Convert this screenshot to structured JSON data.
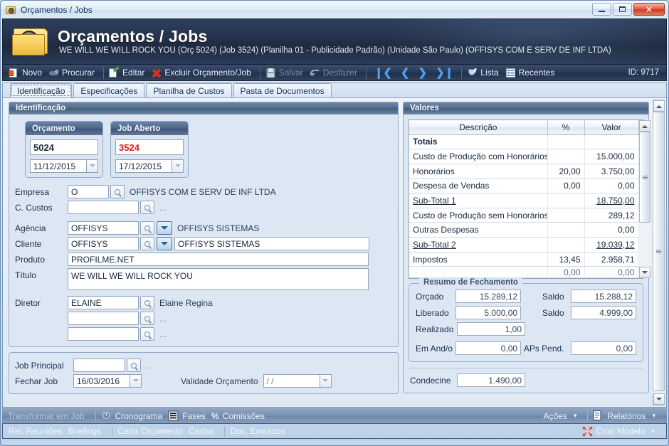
{
  "window": {
    "titlebar_text": "Orçamentos / Jobs",
    "icon": "folder-film-icon",
    "minimize_label": "Minimizar",
    "maximize_label": "Maximizar",
    "close_label": "✕"
  },
  "banner": {
    "title": "Orçamentos / Jobs",
    "subtitle": "WE WILL WE WILL ROCK YOU (Orç 5024) (Job 3524)  (Planilha 01 - Publicidade Padrão) (Unidade São Paulo) (OFFISYS COM E SERV DE INF LTDA)"
  },
  "toolbar": {
    "novo": "Novo",
    "procurar": "Procurar",
    "editar": "Editar",
    "excluir": "Excluir Orçamento/Job",
    "salvar": "Salvar",
    "desfazer": "Desfazer",
    "nav_first": "❙❮",
    "nav_prev": "❮",
    "nav_next": "❯",
    "nav_last": "❯❙",
    "lista": "Lista",
    "recentes": "Recentes",
    "id": "ID: 9717"
  },
  "tabs": [
    {
      "label": "Identificação",
      "active": true
    },
    {
      "label": "Especificações",
      "active": false
    },
    {
      "label": "Planilha de Custos",
      "active": false
    },
    {
      "label": "Pasta de Documentos",
      "active": false
    }
  ],
  "identificacao": {
    "group_title": "Identificação",
    "orcamento": {
      "header": "Orçamento",
      "number": "5024",
      "date": "11/12/2015"
    },
    "job_aberto": {
      "header": "Job Aberto",
      "number": "3524",
      "date": "17/12/2015"
    },
    "fields": {
      "empresa_label": "Empresa",
      "empresa_value": "O",
      "empresa_desc": "OFFISYS COM E SERV DE INF LTDA",
      "ccustos_label": "C. Custos",
      "ccustos_value": "",
      "ccustos_desc": "...",
      "agencia_label": "Agência",
      "agencia_value": "OFFISYS",
      "agencia_desc": "OFFISYS SISTEMAS",
      "cliente_label": "Cliente",
      "cliente_value": "OFFISYS",
      "cliente_desc": "OFFISYS SISTEMAS",
      "produto_label": "Produto",
      "produto_value": "PROFILME.NET",
      "titulo_label": "Título",
      "titulo_value": "WE WILL WE WILL ROCK YOU",
      "diretor_label": "Diretor",
      "diretor_value": "ELAINE",
      "diretor_desc": "Elaine Regina",
      "extra1_value": "",
      "extra1_desc": "...",
      "extra2_value": "",
      "extra2_desc": "..."
    }
  },
  "job_panel": {
    "job_principal_label": "Job Principal",
    "job_principal_value": "",
    "job_principal_desc": "...",
    "fechar_job_label": "Fechar Job",
    "fechar_job_value": "16/03/2016",
    "validade_label": "Validade Orçamento",
    "validade_value": "/  /"
  },
  "valores": {
    "group_title": "Valores",
    "columns": [
      "Descrição",
      "%",
      "Valor"
    ],
    "rows": [
      {
        "desc": "Totais",
        "pct": "",
        "val": "",
        "style": "bold"
      },
      {
        "desc": "Custo de Produção com Honorários",
        "pct": "",
        "val": "15.000,00",
        "style": ""
      },
      {
        "desc": "Honorários",
        "pct": "20,00",
        "val": "3.750,00",
        "style": ""
      },
      {
        "desc": "Despesa de Vendas",
        "pct": "0,00",
        "val": "0,00",
        "style": ""
      },
      {
        "desc": "Sub-Total 1",
        "pct": "",
        "val": "18.750,00",
        "style": "subtotal"
      },
      {
        "desc": "Custo de Produção sem Honorários",
        "pct": "",
        "val": "289,12",
        "style": ""
      },
      {
        "desc": "Outras Despesas",
        "pct": "",
        "val": "0,00",
        "style": ""
      },
      {
        "desc": "Sub-Total 2",
        "pct": "",
        "val": "19.039,12",
        "style": "subtotal"
      },
      {
        "desc": "Impostos",
        "pct": "13,45",
        "val": "2.958,71",
        "style": ""
      },
      {
        "desc": "",
        "pct": "0,00",
        "val": "0,00",
        "style": "clip"
      }
    ]
  },
  "resumo": {
    "legend": "Resumo de Fechamento",
    "orcado_label": "Orçado",
    "orcado_value": "15.289,12",
    "saldo1_label": "Saldo",
    "saldo1_value": "15.288,12",
    "liberado_label": "Liberado",
    "liberado_value": "5.000,00",
    "saldo2_label": "Saldo",
    "saldo2_value": "4.999,00",
    "realizado_label": "Realizado",
    "realizado_value": "1,00",
    "emando_label": "Em And/o",
    "emando_value": "0,00",
    "aps_label": "APs Pend.",
    "aps_value": "0,00",
    "condecine_label": "Condecine",
    "condecine_value": "1.490,00"
  },
  "bottom_bar_1": {
    "transformar": "Transformar em Job",
    "cronograma": "Cronograma",
    "fases": "Fases",
    "comissoes": "Comissões",
    "acoes": "Ações",
    "relatorios": "Relatórios"
  },
  "bottom_bar_2": {
    "rel_reunioes": "Rel. Reuniões",
    "briefings": "Briefings",
    "carta_orcamento": "Carta Orçamento",
    "cartas": "Cartas",
    "doc_enviados": "Doc. Enviados",
    "criar_modelo": "Criar Modelo"
  }
}
